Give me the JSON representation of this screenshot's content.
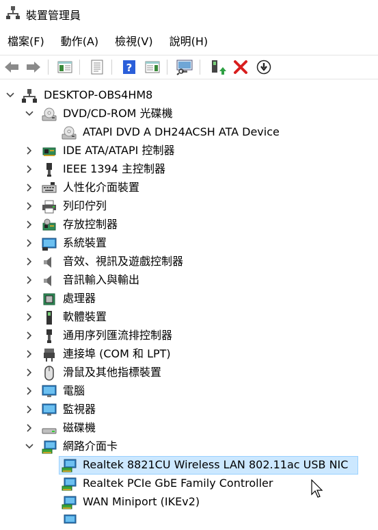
{
  "window": {
    "title": "裝置管理員",
    "app_icon": "device-manager-icon"
  },
  "menu": [
    "檔案(F)",
    "動作(A)",
    "檢視(V)",
    "說明(H)"
  ],
  "toolbar": {
    "buttons": [
      "back-arrow-icon",
      "forward-arrow-icon",
      "show-hide-tree-icon",
      "properties-icon",
      "help-icon",
      "action-pane-icon",
      "scan-hardware-icon",
      "update-driver-icon",
      "uninstall-device-icon",
      "disable-device-icon"
    ],
    "colors": {
      "help": "#2b5fd9",
      "uninstall": "#d81e1e"
    }
  },
  "tree": {
    "root": "DESKTOP-OBS4HM8",
    "dvd": {
      "label": "DVD/CD-ROM 光碟機",
      "children": [
        "ATAPI DVD A  DH24ACSH ATA Device"
      ]
    },
    "categories": [
      "IDE ATA/ATAPI 控制器",
      "IEEE 1394 主控制器",
      "人性化介面裝置",
      "列印佇列",
      "存放控制器",
      "系統裝置",
      "音效、視訊及遊戲控制器",
      "音訊輸入與輸出",
      "處理器",
      "軟體裝置",
      "通用序列匯流排控制器",
      "連接埠 (COM 和 LPT)",
      "滑鼠及其他指標裝置",
      "電腦",
      "監視器",
      "磁碟機"
    ],
    "network": {
      "label": "網路介面卡",
      "children": [
        "Realtek 8821CU Wireless LAN 802.11ac USB NIC",
        "Realtek PCIe GbE Family Controller",
        "WAN Miniport (IKEv2)"
      ]
    },
    "selected_color": "#cce8ff"
  }
}
